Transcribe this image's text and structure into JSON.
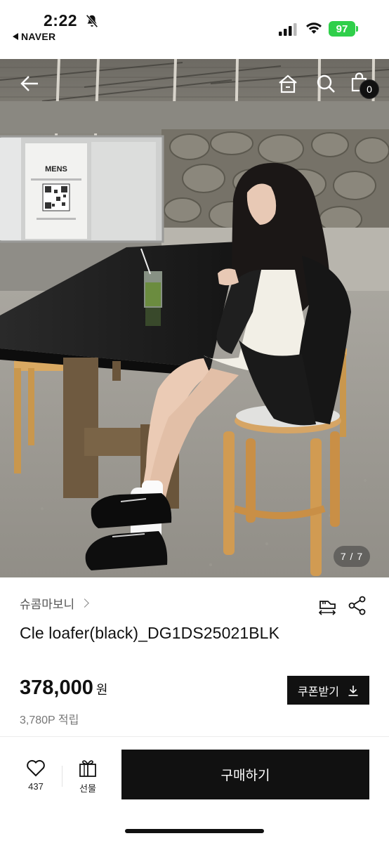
{
  "status_bar": {
    "time": "2:22",
    "back_app": "NAVER",
    "battery": "97"
  },
  "hero": {
    "poster_text": "MENS",
    "counter": "7 / 7",
    "cart_count": "0"
  },
  "product": {
    "brand": "슈콤마보니",
    "title": "Cle loafer(black)_DG1DS25021BLK",
    "price": "378,000",
    "price_unit": "원",
    "points": "3,780P 적립"
  },
  "coupon_button": {
    "label": "쿠폰받기"
  },
  "bottom_bar": {
    "wish_count": "437",
    "gift_label": "선물",
    "buy_label": "구매하기"
  },
  "icons": [
    "bell-slash-icon",
    "signal-icon",
    "wifi-icon",
    "back-arrow-icon",
    "home-icon",
    "search-icon",
    "cart-icon",
    "compare-icon",
    "share-icon",
    "download-icon",
    "heart-icon",
    "gift-icon"
  ]
}
